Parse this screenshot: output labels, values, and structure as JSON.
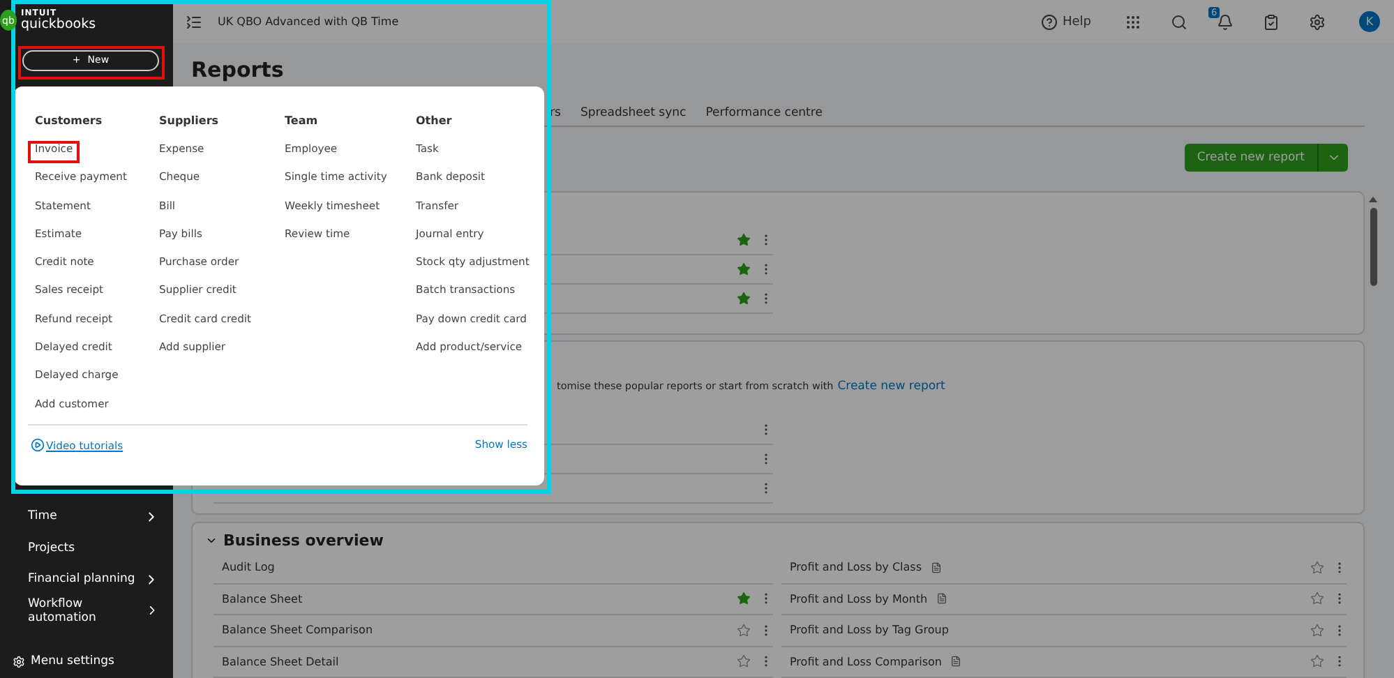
{
  "sidebar": {
    "logo": {
      "mark": "qb",
      "brand": "INTUIT",
      "product": "quickbooks"
    },
    "new_button": {
      "icon": "+",
      "label": "New"
    },
    "items": [
      {
        "label": "Time",
        "submenu": true
      },
      {
        "label": "Projects",
        "submenu": false
      },
      {
        "label": "Financial planning",
        "submenu": true
      },
      {
        "label": "Workflow automation",
        "submenu": true
      }
    ],
    "footer": "Menu settings"
  },
  "top_bar": {
    "company": "UK QBO Advanced with QB Time",
    "help": "Help",
    "notification_count": "6",
    "avatar": "K"
  },
  "page": {
    "title": "Reports",
    "tabs": [
      {
        "label": "rs",
        "selected": false
      },
      {
        "label": "Spreadsheet sync",
        "selected": false
      },
      {
        "label": "Performance centre",
        "selected": false
      }
    ],
    "create_button": "Create new report"
  },
  "favourites": {
    "rows": [
      {
        "favourite": true
      },
      {
        "favourite": true
      },
      {
        "favourite": true
      }
    ]
  },
  "popular": {
    "description": "tomise these popular reports or start from scratch with",
    "link": "Create new report",
    "rows": [
      {
        "kind": "covered"
      },
      {
        "kind": "covered"
      },
      {
        "kind": "covered"
      }
    ]
  },
  "business_overview": {
    "title": "Business overview",
    "expanded": true,
    "left": [
      {
        "name": "Audit Log"
      },
      {
        "name": "Balance Sheet",
        "favourite": true
      },
      {
        "name": "Balance Sheet Comparison",
        "favourite": false
      },
      {
        "name": "Balance Sheet Detail",
        "favourite": false
      }
    ],
    "right": [
      {
        "name": "Profit and Loss by Class",
        "favourite": false,
        "report_icon": true
      },
      {
        "name": "Profit and Loss by Month",
        "favourite": false,
        "report_icon": true
      },
      {
        "name": "Profit and Loss by Tag Group",
        "favourite": false,
        "report_icon": false
      },
      {
        "name": "Profit and Loss Comparison",
        "favourite": false,
        "report_icon": true
      }
    ]
  },
  "new_menu": {
    "columns": [
      {
        "heading": "Customers",
        "items": [
          "Invoice",
          "Receive payment",
          "Statement",
          "Estimate",
          "Credit note",
          "Sales receipt",
          "Refund receipt",
          "Delayed credit",
          "Delayed charge",
          "Add customer"
        ]
      },
      {
        "heading": "Suppliers",
        "items": [
          "Expense",
          "Cheque",
          "Bill",
          "Pay bills",
          "Purchase order",
          "Supplier credit",
          "Credit card credit",
          "Add supplier"
        ]
      },
      {
        "heading": "Team",
        "items": [
          "Employee",
          "Single time activity",
          "Weekly timesheet",
          "Review time"
        ]
      },
      {
        "heading": "Other",
        "items": [
          "Task",
          "Bank deposit",
          "Transfer",
          "Journal entry",
          "Stock qty adjustment",
          "Batch transactions",
          "Pay down credit card",
          "Add product/service"
        ]
      }
    ],
    "footer_link": "Video tutorials",
    "toggle": "Show less"
  }
}
